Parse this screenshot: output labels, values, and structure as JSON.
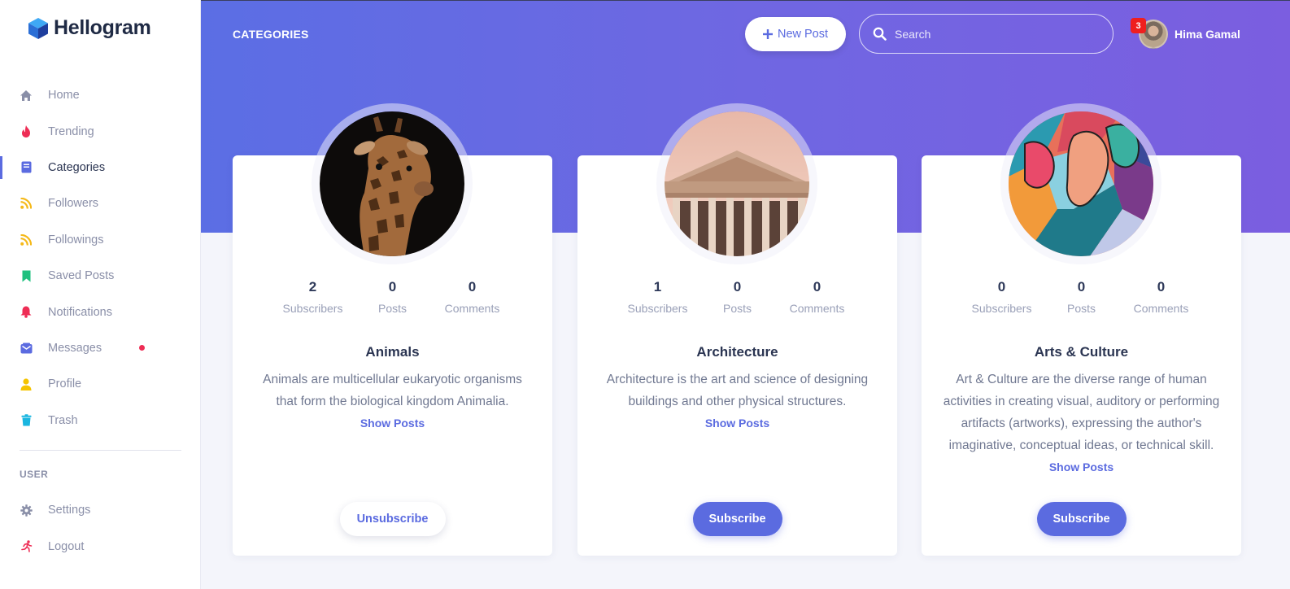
{
  "app": {
    "name": "Hellogram"
  },
  "sidebar": {
    "items": [
      {
        "label": "Home",
        "icon": "home-icon",
        "color": "#8a8fa8"
      },
      {
        "label": "Trending",
        "icon": "flame-icon",
        "color": "#ee2d55"
      },
      {
        "label": "Categories",
        "icon": "book-icon",
        "color": "#5b6be0",
        "active": true
      },
      {
        "label": "Followers",
        "icon": "rss-icon",
        "color": "#f5b91a"
      },
      {
        "label": "Followings",
        "icon": "rss-icon",
        "color": "#f5b91a"
      },
      {
        "label": "Saved Posts",
        "icon": "bookmark-icon",
        "color": "#1fc07f"
      },
      {
        "label": "Notifications",
        "icon": "bell-icon",
        "color": "#ee2d55"
      },
      {
        "label": "Messages",
        "icon": "envelope-icon",
        "color": "#5b6be0",
        "has_dot": true
      },
      {
        "label": "Profile",
        "icon": "user-icon",
        "color": "#f5c400"
      },
      {
        "label": "Trash",
        "icon": "trash-icon",
        "color": "#1ab6e0"
      }
    ],
    "section_label": "USER",
    "user_items": [
      {
        "label": "Settings",
        "icon": "gear-icon",
        "color": "#8a8fa8"
      },
      {
        "label": "Logout",
        "icon": "running-icon",
        "color": "#ee2d55"
      }
    ]
  },
  "header": {
    "title": "CATEGORIES",
    "new_post_label": "New Post",
    "search_placeholder": "Search",
    "notification_count": "3",
    "user_name": "Hima Gamal"
  },
  "categories": [
    {
      "stats": [
        {
          "value": "2",
          "label": "Subscribers"
        },
        {
          "value": "0",
          "label": "Posts"
        },
        {
          "value": "0",
          "label": "Comments"
        }
      ],
      "title": "Animals",
      "description": "Animals are multicellular eukaryotic organisms that form the biological kingdom Animalia.",
      "link": "Show Posts",
      "button": "Unsubscribe"
    },
    {
      "stats": [
        {
          "value": "1",
          "label": "Subscribers"
        },
        {
          "value": "0",
          "label": "Posts"
        },
        {
          "value": "0",
          "label": "Comments"
        }
      ],
      "title": "Architecture",
      "description": "Architecture is the art and science of designing buildings and other physical structures.",
      "link": "Show Posts",
      "button": "Subscribe"
    },
    {
      "stats": [
        {
          "value": "0",
          "label": "Subscribers"
        },
        {
          "value": "0",
          "label": "Posts"
        },
        {
          "value": "0",
          "label": "Comments"
        }
      ],
      "title": "Arts & Culture",
      "description": "Art & Culture are the diverse range of human activities in creating visual, auditory or performing artifacts (artworks), expressing the author's imaginative, conceptual ideas, or technical skill.",
      "link": "Show Posts",
      "button": "Subscribe"
    }
  ]
}
